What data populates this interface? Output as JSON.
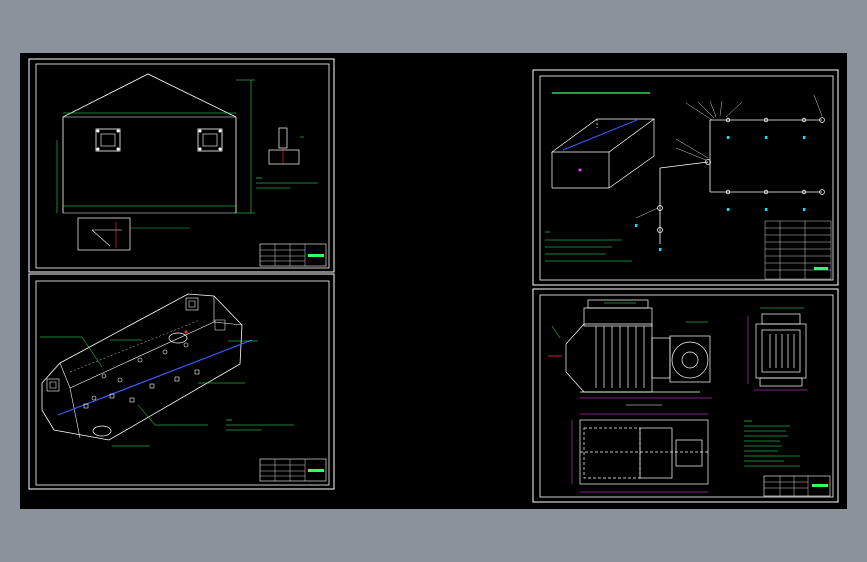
{
  "app": {
    "background": "#8c929b",
    "paper": "#000000",
    "frame": "#ffffff"
  },
  "sheets": {
    "top_left": {
      "title_block": {
        "label": "",
        "lines": [
          "",
          ""
        ]
      }
    },
    "bottom_left": {
      "title_block": {
        "label": ""
      }
    },
    "top_right": {
      "heading": "",
      "notes_title": "",
      "title_block": {
        "label": ""
      }
    },
    "bottom_right": {
      "view_label": "",
      "notes_title": "",
      "title_block": {
        "label": ""
      }
    }
  },
  "colors": {
    "green": "#33ff66",
    "yellow": "#ffe14a",
    "white": "#ffffff",
    "blue": "#3a5cff",
    "magenta": "#ff40ff",
    "cyan": "#00e5ff",
    "red": "#ff3030"
  }
}
